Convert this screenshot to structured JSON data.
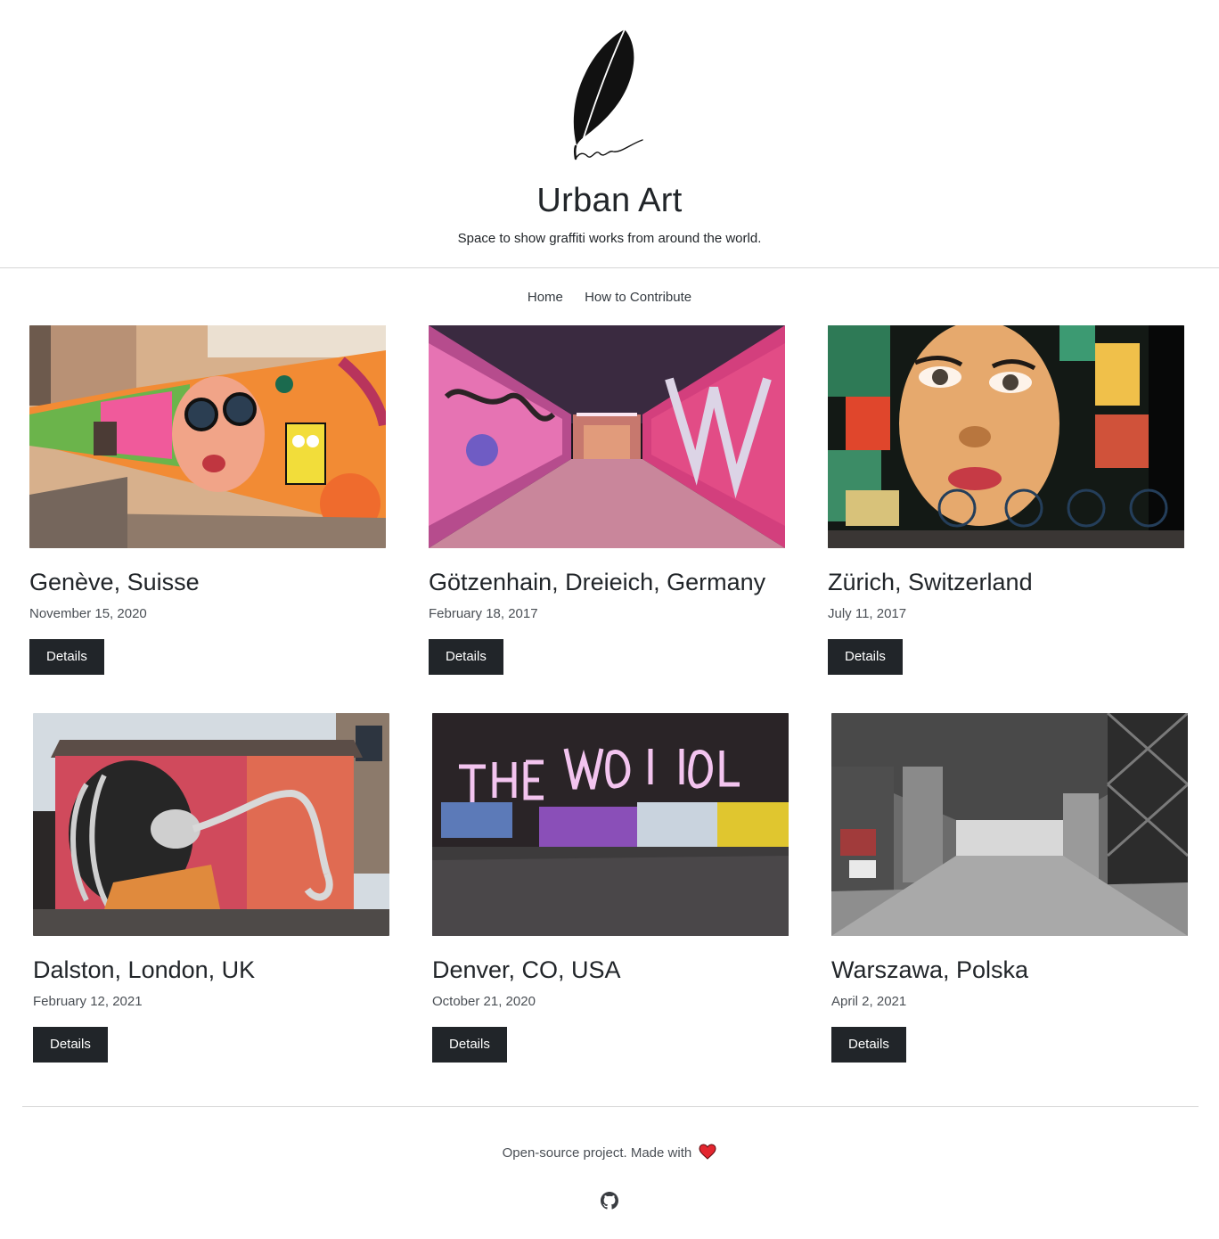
{
  "site": {
    "title": "Urban Art",
    "subtitle": "Space to show graffiti works from around the world."
  },
  "nav": {
    "items": [
      {
        "label": "Home"
      },
      {
        "label": "How to Contribute"
      }
    ]
  },
  "cards": [
    {
      "location": "Genève, Suisse",
      "date": "November 15, 2020",
      "button_label": "Details"
    },
    {
      "location": "Götzenhain, Dreieich, Germany",
      "date": "February 18, 2017",
      "button_label": "Details"
    },
    {
      "location": "Zürich, Switzerland",
      "date": "July 11, 2017",
      "button_label": "Details"
    },
    {
      "location": "Dalston, London, UK",
      "date": "February 12, 2021",
      "button_label": "Details"
    },
    {
      "location": "Denver, CO, USA",
      "date": "October 21, 2020",
      "button_label": "Details"
    },
    {
      "location": "Warszawa, Polska",
      "date": "April 2, 2021",
      "button_label": "Details"
    }
  ],
  "footer": {
    "text": "Open-source project. Made with",
    "heart_icon": "heart-icon",
    "github_icon": "github-icon"
  },
  "colors": {
    "text": "#212529",
    "button": "#212529",
    "heart": "#e3262f"
  }
}
